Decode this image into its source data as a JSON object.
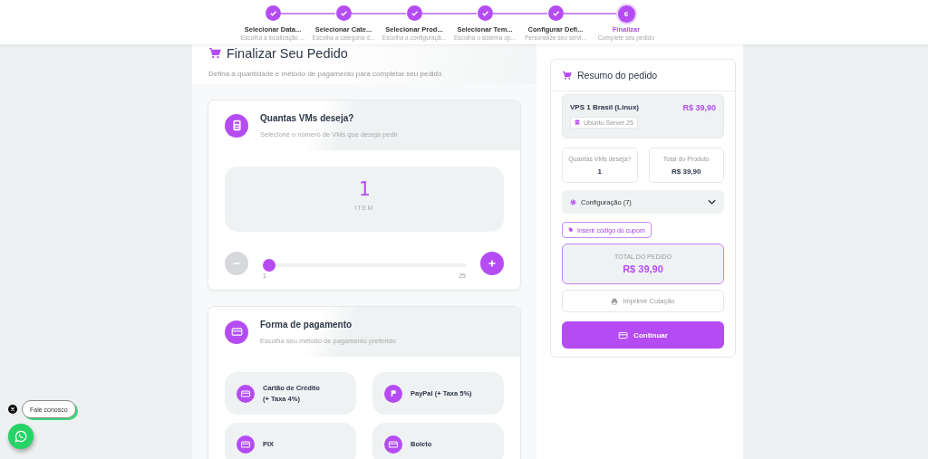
{
  "steps": [
    {
      "title": "Selecionar Data...",
      "subtitle": "Escolha a localização ...",
      "done": true
    },
    {
      "title": "Selecionar Cate...",
      "subtitle": "Escolha a categoria d...",
      "done": true
    },
    {
      "title": "Selecionar Prod...",
      "subtitle": "Escolha a configuraçã...",
      "done": true
    },
    {
      "title": "Selecionar Tem...",
      "subtitle": "Escolha o sistema op...",
      "done": true
    },
    {
      "title": "Configurar Defi...",
      "subtitle": "Personalize seu servi...",
      "done": true
    },
    {
      "title": "Finalizar",
      "subtitle": "Complete seu pedido",
      "done": false,
      "number": "6"
    }
  ],
  "page": {
    "title": "Finalizar Seu Pedido",
    "subtitle": "Defina a quantidade e método de pagamento para completar seu pedido"
  },
  "quantity": {
    "title": "Quantas VMs deseja?",
    "subtitle": "Selecione o número de VMs que deseja pedir",
    "value": "1",
    "unit": "ITEM",
    "level": 0,
    "min": "1",
    "max": "25"
  },
  "payment": {
    "title": "Forma de pagamento",
    "subtitle": "Escolha seu método de pagamento preferido",
    "options": [
      {
        "label": "Cartão de Crédito\n(+ Taxa 4%)",
        "kind": "card",
        "selected": false
      },
      {
        "label": "PayPal (+ Taxa 5%)",
        "kind": "paypal",
        "selected": false
      },
      {
        "label": "PIX",
        "kind": "card",
        "selected": false
      },
      {
        "label": "Boleto",
        "kind": "card",
        "selected": false
      }
    ]
  },
  "summary": {
    "title": "Resumo do pedido",
    "product": "VPS 1 Brasil (Linux)",
    "price": "R$ 39,90",
    "os": "Ubuntu Server 25",
    "stats": [
      {
        "label": "Quantas VMs deseja?",
        "value": "1"
      },
      {
        "label": "Total do Produto",
        "value": "R$ 39,90"
      }
    ],
    "config": {
      "label": "Configuração (7)",
      "expanded": false
    },
    "coupon": "Inserir código do cupom",
    "total_label": "TOTAL DO PEDIDO",
    "total": "R$ 39,90",
    "print": "Imprimir Cotação",
    "continue": "Continuar"
  },
  "chat": {
    "label": "Fale conosco"
  }
}
